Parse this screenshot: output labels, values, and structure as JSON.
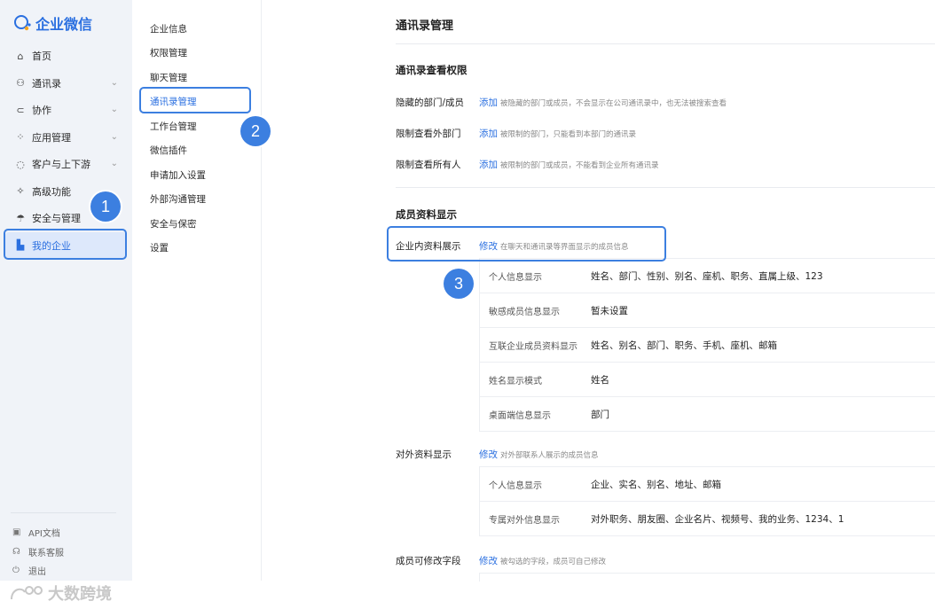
{
  "app": {
    "logo_text": "企业微信"
  },
  "sidebar": {
    "items": [
      {
        "label": "首页",
        "icon": "home-icon"
      },
      {
        "label": "通讯录",
        "icon": "contacts-icon"
      },
      {
        "label": "协作",
        "icon": "collab-icon"
      },
      {
        "label": "应用管理",
        "icon": "apps-icon"
      },
      {
        "label": "客户与上下游",
        "icon": "customer-icon"
      },
      {
        "label": "高级功能",
        "icon": "advanced-icon"
      },
      {
        "label": "安全与管理",
        "icon": "security-icon"
      },
      {
        "label": "我的企业",
        "icon": "enterprise-icon"
      }
    ],
    "bottom": [
      {
        "label": "API文档",
        "icon": "api-doc-icon"
      },
      {
        "label": "联系客服",
        "icon": "support-icon"
      },
      {
        "label": "退出",
        "icon": "logout-icon"
      }
    ]
  },
  "submenu": {
    "items": [
      "企业信息",
      "权限管理",
      "聊天管理",
      "通讯录管理",
      "工作台管理",
      "微信插件",
      "申请加入设置",
      "外部沟通管理",
      "安全与保密",
      "设置"
    ]
  },
  "badges": [
    "1",
    "2",
    "3"
  ],
  "main": {
    "title": "通讯录管理",
    "view_perm": {
      "title": "通讯录查看权限",
      "rows": [
        {
          "label": "隐藏的部门/成员",
          "link": "添加",
          "desc": "被隐藏的部门或成员，不会显示在公司通讯录中，也无法被搜索查看"
        },
        {
          "label": "限制查看外部门",
          "link": "添加",
          "desc": "被限制的部门，只能看到本部门的通讯录"
        },
        {
          "label": "限制查看所有人",
          "link": "添加",
          "desc": "被限制的部门或成员，不能看到企业所有通讯录"
        }
      ]
    },
    "member_display": {
      "title": "成员资料显示",
      "internal": {
        "label": "企业内资料展示",
        "link": "修改",
        "desc": "在聊天和通讯录等界面显示的成员信息",
        "rows": [
          {
            "k": "个人信息显示",
            "v": "姓名、部门、性别、别名、座机、职务、直属上级、123"
          },
          {
            "k": "敏感成员信息显示",
            "v": "暂未设置"
          },
          {
            "k": "互联企业成员资料显示",
            "v": "姓名、别名、部门、职务、手机、座机、邮箱"
          },
          {
            "k": "姓名显示模式",
            "v": "姓名"
          },
          {
            "k": "桌面端信息显示",
            "v": "部门"
          }
        ]
      },
      "external": {
        "label": "对外资料显示",
        "link": "修改",
        "desc": "对外部联系人展示的成员信息",
        "rows": [
          {
            "k": "个人信息显示",
            "v": "企业、实名、别名、地址、邮箱"
          },
          {
            "k": "专属对外信息显示",
            "v": "对外职务、朋友圈、企业名片、视频号、我的业务、1234、1"
          }
        ]
      },
      "editable": {
        "label": "成员可修改字段",
        "link": "修改",
        "desc": "被勾选的字段，成员可自己修改"
      }
    }
  },
  "watermark": "大数跨境",
  "colors": {
    "accent": "#2a6fe0",
    "highlight": "#3c7fe0",
    "sidebar_bg": "#f0f3f8"
  }
}
